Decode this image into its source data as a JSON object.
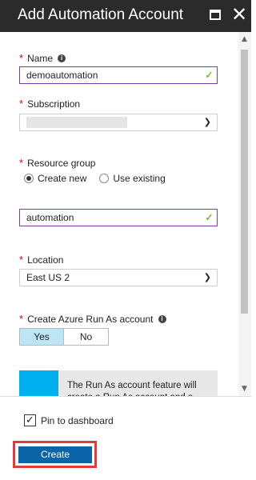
{
  "header": {
    "title": "Add Automation Account"
  },
  "form": {
    "name": {
      "label": "Name",
      "value": "demoautomation"
    },
    "subscription": {
      "label": "Subscription",
      "value": ""
    },
    "resource_group": {
      "label": "Resource group",
      "options": [
        "Create new",
        "Use existing"
      ],
      "selected": "Create new",
      "value": "automation"
    },
    "location": {
      "label": "Location",
      "value": "East US 2"
    },
    "run_as": {
      "label": "Create Azure Run As account",
      "options": [
        "Yes",
        "No"
      ],
      "selected": "Yes"
    },
    "notice": {
      "text": "The Run As account feature will create a Run As account and a"
    }
  },
  "footer": {
    "pin_label": "Pin to dashboard",
    "pin_checked": true,
    "create_label": "Create"
  },
  "colors": {
    "titlebar": "#2b2b2b",
    "accent_blue": "#00aff0",
    "button_blue": "#0b63a8",
    "highlight_red": "#e03c3c",
    "valid_green": "#57a300",
    "focus_purple": "#7a3f9d"
  }
}
